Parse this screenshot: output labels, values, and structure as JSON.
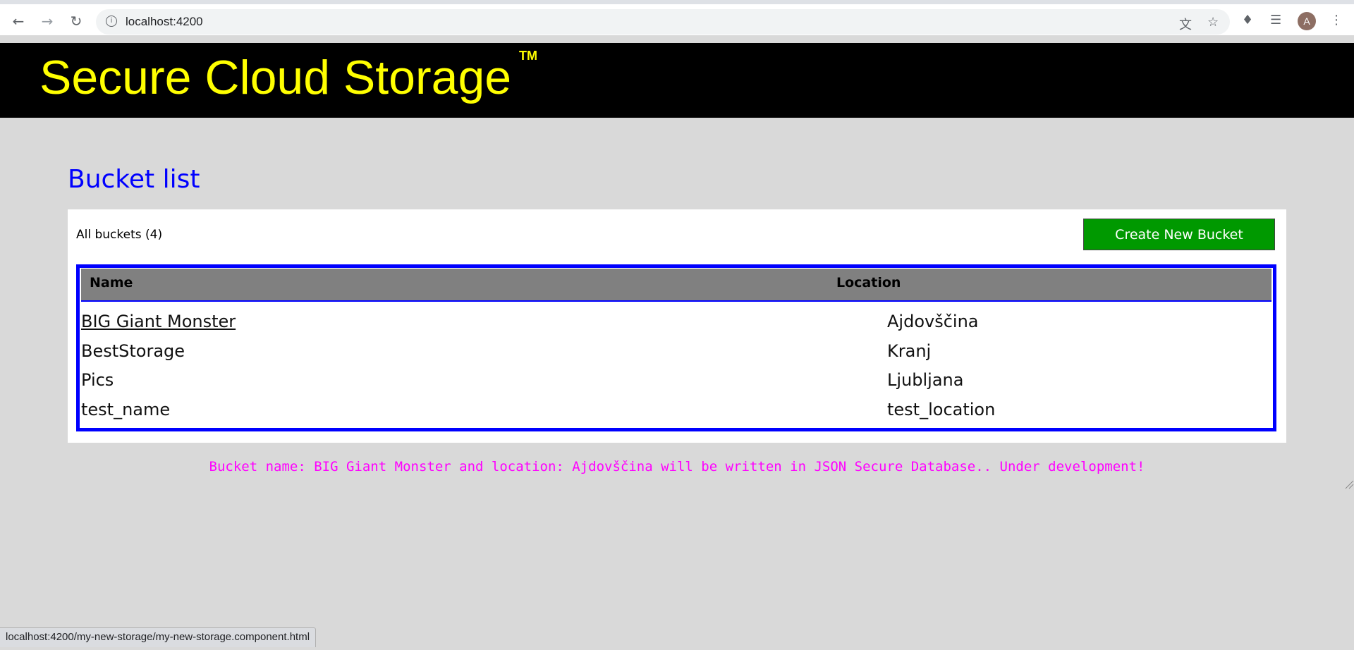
{
  "browser": {
    "url": "localhost:4200",
    "avatar_letter": "A",
    "status_url": "localhost:4200/my-new-storage/my-new-storage.component.html"
  },
  "header": {
    "title": "Secure Cloud Storage",
    "trademark": "TM",
    "title_color": "#ffff00",
    "background": "#000000"
  },
  "main": {
    "page_title": "Bucket list",
    "count_label": "All buckets (4)",
    "create_button_label": "Create New Bucket",
    "table": {
      "columns": [
        "Name",
        "Location"
      ],
      "rows": [
        {
          "name": "BIG Giant Monster",
          "location": "Ajdovščina"
        },
        {
          "name": "BestStorage",
          "location": "Kranj"
        },
        {
          "name": "Pics",
          "location": "Ljubljana"
        },
        {
          "name": "test_name",
          "location": "test_location"
        }
      ]
    },
    "message": "Bucket name: BIG Giant Monster and location: Ajdovščina will be written in JSON Secure Database.. Under development!"
  },
  "colors": {
    "accent_blue": "#0000ff",
    "button_green": "#009900",
    "message_magenta": "#ff00ff",
    "header_gray": "#808080"
  },
  "icons": [
    "back-arrow-icon",
    "forward-arrow-icon",
    "reload-icon",
    "site-info-icon",
    "translate-icon",
    "bookmark-star-icon",
    "extensions-icon",
    "media-control-icon",
    "menu-dots-icon",
    "resize-grip-icon"
  ]
}
